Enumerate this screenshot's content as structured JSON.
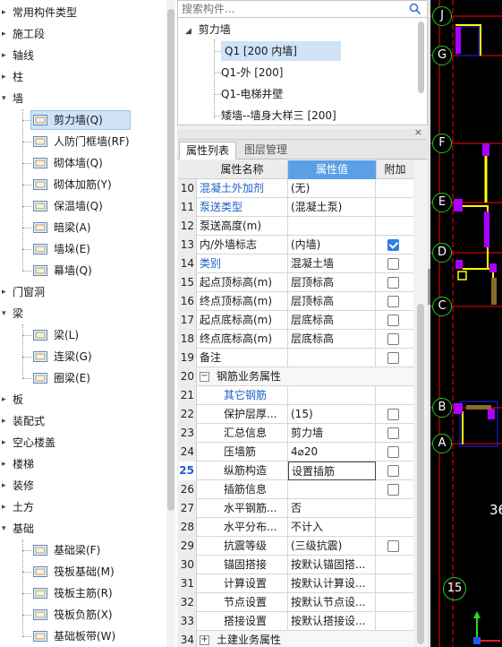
{
  "tree": {
    "items": [
      {
        "label": "常用构件类型",
        "kind": "top",
        "exp": "▸"
      },
      {
        "label": "施工段",
        "kind": "top",
        "exp": "▸"
      },
      {
        "label": "轴线",
        "kind": "top",
        "exp": "▸"
      },
      {
        "label": "柱",
        "kind": "top",
        "exp": "▸"
      },
      {
        "label": "墙",
        "kind": "top",
        "exp": "▾"
      },
      {
        "label": "剪力墙(Q)",
        "kind": "child",
        "icon": "shear-wall-icon",
        "selected": true
      },
      {
        "label": "人防门框墙(RF)",
        "kind": "child",
        "icon": "civil-defense-door-wall-icon"
      },
      {
        "label": "砌体墙(Q)",
        "kind": "child",
        "icon": "masonry-wall-icon"
      },
      {
        "label": "砌体加筋(Y)",
        "kind": "child",
        "icon": "masonry-rebar-icon"
      },
      {
        "label": "保温墙(Q)",
        "kind": "child",
        "icon": "insulation-wall-icon"
      },
      {
        "label": "暗梁(A)",
        "kind": "child",
        "icon": "hidden-beam-icon"
      },
      {
        "label": "墙垛(E)",
        "kind": "child",
        "icon": "wall-pier-icon"
      },
      {
        "label": "幕墙(Q)",
        "kind": "child",
        "icon": "curtain-wall-icon"
      },
      {
        "label": "门窗洞",
        "kind": "top",
        "exp": "▸"
      },
      {
        "label": "梁",
        "kind": "top",
        "exp": "▾"
      },
      {
        "label": "梁(L)",
        "kind": "child",
        "icon": "beam-icon"
      },
      {
        "label": "连梁(G)",
        "kind": "child",
        "icon": "coupling-beam-icon"
      },
      {
        "label": "圈梁(E)",
        "kind": "child",
        "icon": "ring-beam-icon"
      },
      {
        "label": "板",
        "kind": "top",
        "exp": "▸"
      },
      {
        "label": "装配式",
        "kind": "top",
        "exp": "▸"
      },
      {
        "label": "空心楼盖",
        "kind": "top",
        "exp": "▸"
      },
      {
        "label": "楼梯",
        "kind": "top",
        "exp": "▸"
      },
      {
        "label": "装修",
        "kind": "top",
        "exp": "▸"
      },
      {
        "label": "土方",
        "kind": "top",
        "exp": "▸"
      },
      {
        "label": "基础",
        "kind": "top",
        "exp": "▾"
      },
      {
        "label": "基础梁(F)",
        "kind": "child",
        "icon": "foundation-beam-icon"
      },
      {
        "label": "筏板基础(M)",
        "kind": "child",
        "icon": "raft-foundation-icon"
      },
      {
        "label": "筏板主筋(R)",
        "kind": "child",
        "icon": "raft-main-rebar-icon"
      },
      {
        "label": "筏板负筋(X)",
        "kind": "child",
        "icon": "raft-negative-rebar-icon"
      },
      {
        "label": "基础板带(W)",
        "kind": "child",
        "icon": "foundation-strip-icon"
      }
    ]
  },
  "search": {
    "placeholder": "搜索构件..."
  },
  "components": {
    "group": "剪力墙",
    "items": [
      {
        "label": "Q1 [200 内墙]",
        "selected": true
      },
      {
        "label": "Q1-外 [200]"
      },
      {
        "label": "Q1-电梯井壁"
      },
      {
        "label": "矮墙--墙身大样三 [200]"
      }
    ]
  },
  "tabs": {
    "properties": "属性列表",
    "layers": "图层管理"
  },
  "grid": {
    "header": {
      "name": "属性名称",
      "value": "属性值",
      "extra": "附加"
    },
    "rows": [
      {
        "num": "10",
        "name": "混凝土外加剂",
        "value": "(无)",
        "blue": true,
        "check": "none"
      },
      {
        "num": "11",
        "name": "泵送类型",
        "value": "(混凝土泵)",
        "blue": true,
        "check": "none"
      },
      {
        "num": "12",
        "name": "泵送高度(m)",
        "value": "",
        "check": "none"
      },
      {
        "num": "13",
        "name": "内/外墙标志",
        "value": "(内墙)",
        "check": "on"
      },
      {
        "num": "14",
        "name": "类别",
        "value": "混凝土墙",
        "blue": true,
        "check": "off"
      },
      {
        "num": "15",
        "name": "起点顶标高(m)",
        "value": "层顶标高",
        "check": "off"
      },
      {
        "num": "16",
        "name": "终点顶标高(m)",
        "value": "层顶标高",
        "check": "off"
      },
      {
        "num": "17",
        "name": "起点底标高(m)",
        "value": "层底标高",
        "check": "off"
      },
      {
        "num": "18",
        "name": "终点底标高(m)",
        "value": "层底标高",
        "check": "off"
      },
      {
        "num": "19",
        "name": "备注",
        "value": "",
        "check": "off"
      },
      {
        "num": "20",
        "name": "钢筋业务属性",
        "value": "",
        "group": true,
        "toggle": "−"
      },
      {
        "num": "21",
        "name": "其它钢筋",
        "value": "",
        "blue": true,
        "indent": true,
        "check": "none"
      },
      {
        "num": "22",
        "name": "保护层厚...",
        "value": "(15)",
        "indent": true,
        "check": "off"
      },
      {
        "num": "23",
        "name": "汇总信息",
        "value": "剪力墙",
        "indent": true,
        "check": "off"
      },
      {
        "num": "24",
        "name": "压墙筋",
        "value": "4⌀20",
        "indent": true,
        "check": "off"
      },
      {
        "num": "25",
        "name": "纵筋构造",
        "value": "设置插筋",
        "indent": true,
        "check": "off",
        "current": true
      },
      {
        "num": "26",
        "name": "插筋信息",
        "value": "",
        "indent": true,
        "check": "off"
      },
      {
        "num": "27",
        "name": "水平钢筋...",
        "value": "否",
        "indent": true,
        "check": "none"
      },
      {
        "num": "28",
        "name": "水平分布...",
        "value": "不计入",
        "indent": true,
        "check": "none"
      },
      {
        "num": "29",
        "name": "抗震等级",
        "value": "(三级抗震)",
        "indent": true,
        "check": "off"
      },
      {
        "num": "30",
        "name": "锚固搭接",
        "value": "按默认锚固搭...",
        "indent": true,
        "check": "none"
      },
      {
        "num": "31",
        "name": "计算设置",
        "value": "按默认计算设...",
        "indent": true,
        "check": "none"
      },
      {
        "num": "32",
        "name": "节点设置",
        "value": "按默认节点设...",
        "indent": true,
        "check": "none"
      },
      {
        "num": "33",
        "name": "搭接设置",
        "value": "按默认搭接设...",
        "indent": true,
        "check": "none"
      },
      {
        "num": "34",
        "name": "土建业务属性",
        "value": "",
        "group": true,
        "toggle": "+"
      }
    ]
  },
  "canvas": {
    "axis_labels": [
      "J",
      "G",
      "F",
      "E",
      "D",
      "C",
      "B",
      "A"
    ],
    "bottom_labels": [
      "36",
      "15"
    ],
    "colors": {
      "wall": "#ffff00",
      "column": "#aa00ff",
      "grid": "#ff0000",
      "axis_circle": "#22cc22",
      "beam": "#2020ff"
    }
  }
}
